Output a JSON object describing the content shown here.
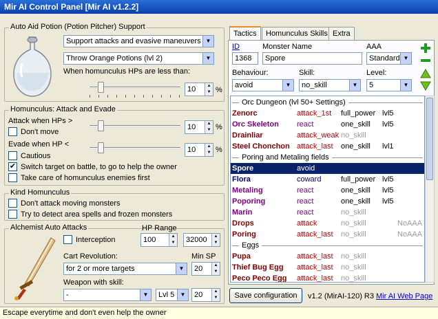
{
  "window": {
    "title": "Mir AI Control Panel [Mir AI v1.2.2]"
  },
  "aid": {
    "title": "Auto Aid Potion (Potion Pitcher) Support",
    "mode": "Support attacks and evasive maneuvers",
    "potion": "Throw Orange Potions (lvl 2)",
    "hp_label": "When homunculus HPs are less than:",
    "hp_value": "10",
    "unit": "%"
  },
  "attack": {
    "title": "Homunculus: Attack and Evade",
    "attack_label": "Attack when HPs >",
    "attack_value": "10",
    "dont_move": "Don't move",
    "evade_label": "Evade when HP <",
    "evade_value": "10",
    "cautious": "Cautious",
    "switch_target": "Switch target on battle, to go to help the owner",
    "take_care": "Take care of homunculus enemies first",
    "unit": "%"
  },
  "kind": {
    "title": "Kind Homunculus",
    "dont_attack": "Don't attack moving monsters",
    "detect_spells": "Try to detect area spells and frozen monsters"
  },
  "alchemist": {
    "title": "Alchemist Auto Attacks",
    "interception": "Interception",
    "hp_range_label": "HP Range",
    "hp_min": "100",
    "hp_max": "32000",
    "cart_label": "Cart Revolution:",
    "cart_value": "for 2 or more targets",
    "min_sp_label": "Min SP",
    "min_sp_value": "20",
    "weapon_label": "Weapon with skill:",
    "weapon_value": "-",
    "weapon_level": "Lvl 5",
    "weapon_sp": "20"
  },
  "tabs": [
    "Tactics",
    "Homunculus Skills",
    "Extra"
  ],
  "form": {
    "id_label": "ID",
    "id_value": "1368",
    "name_label": "Monster Name",
    "name_value": "Spore",
    "aaa_label": "AAA",
    "aaa_value": "Standard",
    "behaviour_label": "Behaviour:",
    "behaviour_value": "avoid",
    "skill_label": "Skill:",
    "skill_value": "no_skill",
    "level_label": "Level:",
    "level_value": "5"
  },
  "colors": {
    "title_dark": "#800000",
    "title_purple": "#800080",
    "title_blue": "#000080",
    "behaviour_red": "#c00000",
    "grey": "#999999",
    "selection": "#0a246a",
    "add_green": "#1e9e1e",
    "arrow_green": "#6fbf1a"
  },
  "sections": {
    "orc": "Orc Dungeon (lvl 50+ Settings)",
    "poring": "Poring and Metaling fields",
    "eggs": "Eggs"
  },
  "orc_rows": [
    {
      "name": "Zenorc",
      "beh": "attack_1st",
      "skill": "full_power",
      "lvl": "lvl5",
      "aaa": ""
    },
    {
      "name": "Orc Skeleton",
      "beh": "react",
      "skill": "one_skill",
      "lvl": "lvl5",
      "aaa": ""
    },
    {
      "name": "Drainliar",
      "beh": "attack_weak",
      "skill": "no_skill",
      "lvl": "",
      "aaa": ""
    },
    {
      "name": "Steel Chonchon",
      "beh": "attack_last",
      "skill": "one_skill",
      "lvl": "lvl1",
      "aaa": ""
    }
  ],
  "poring_rows": [
    {
      "name": "Spore",
      "beh": "avoid",
      "skill": "",
      "lvl": "",
      "aaa": ""
    },
    {
      "name": "Flora",
      "beh": "coward",
      "skill": "full_power",
      "lvl": "lvl5",
      "aaa": ""
    },
    {
      "name": "Metaling",
      "beh": "react",
      "skill": "one_skill",
      "lvl": "lvl5",
      "aaa": ""
    },
    {
      "name": "Poporing",
      "beh": "react",
      "skill": "one_skill",
      "lvl": "lvl5",
      "aaa": ""
    },
    {
      "name": "Marin",
      "beh": "react",
      "skill": "no_skill",
      "lvl": "",
      "aaa": ""
    },
    {
      "name": "Drops",
      "beh": "attack",
      "skill": "no_skill",
      "lvl": "",
      "aaa": "NoAAA"
    },
    {
      "name": "Poring",
      "beh": "attack_last",
      "skill": "no_skill",
      "lvl": "",
      "aaa": "NoAAA"
    }
  ],
  "egg_rows": [
    {
      "name": "Pupa",
      "beh": "attack_last",
      "skill": "no_skill",
      "lvl": "",
      "aaa": ""
    },
    {
      "name": "Thief Bug Egg",
      "beh": "attack_last",
      "skill": "no_skill",
      "lvl": "",
      "aaa": ""
    },
    {
      "name": "Peco Peco Egg",
      "beh": "attack_last",
      "skill": "no_skill",
      "lvl": "",
      "aaa": ""
    }
  ],
  "footer": {
    "save": "Save configuration",
    "version": "v1.2 (MirAI-120) R3",
    "web": "Mir AI Web Page"
  },
  "status": "Escape everytime and don't even help the owner",
  "icons": {
    "add": "plus-icon",
    "remove": "minus-icon",
    "up": "arrow-up-icon",
    "down": "arrow-down-icon",
    "potion": "potion-bottle-icon",
    "sword": "sword-icon",
    "check": "check-icon",
    "dropdown": "chevron-down-icon"
  }
}
